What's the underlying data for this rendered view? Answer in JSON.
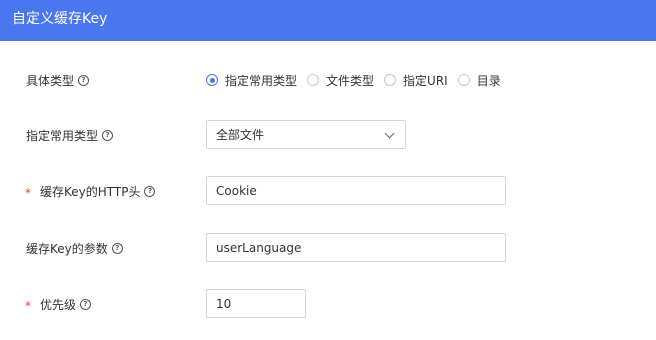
{
  "dialog": {
    "title": "自定义缓存Key"
  },
  "fields": {
    "type": {
      "label": "具体类型",
      "help_icon": "question-circle-icon",
      "options": [
        "指定常用类型",
        "文件类型",
        "指定URI",
        "目录"
      ],
      "selected": "指定常用类型"
    },
    "common_type": {
      "label": "指定常用类型",
      "help_icon": "question-circle-icon",
      "value": "全部文件"
    },
    "http_header": {
      "required_mark": "*",
      "label": "缓存Key的HTTP头",
      "help_icon": "question-circle-icon",
      "value": "Cookie"
    },
    "params": {
      "label": "缓存Key的参数",
      "help_icon": "question-circle-icon",
      "value": "userLanguage"
    },
    "priority": {
      "required_mark": "*",
      "label": "优先级",
      "help_icon": "question-circle-icon",
      "value": "10"
    }
  },
  "colors": {
    "accent": "#4a76f0",
    "required": "#e8433a"
  }
}
